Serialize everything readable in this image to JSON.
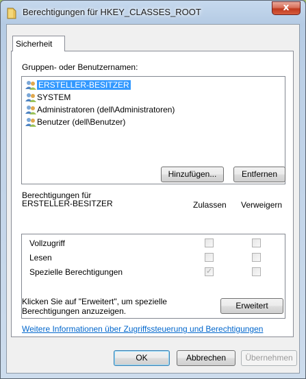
{
  "window": {
    "title": "Berechtigungen für HKEY_CLASSES_ROOT",
    "close_label": "x"
  },
  "tabs": [
    {
      "label": "Sicherheit",
      "active": true
    }
  ],
  "groups": {
    "label": "Gruppen- oder Benutzernamen:",
    "items": [
      {
        "label": "ERSTELLER-BESITZER",
        "selected": true
      },
      {
        "label": "SYSTEM",
        "selected": false
      },
      {
        "label": "Administratoren (dell\\Administratoren)",
        "selected": false
      },
      {
        "label": "Benutzer (dell\\Benutzer)",
        "selected": false
      }
    ],
    "add_label": "Hinzufügen...",
    "remove_label": "Entfernen"
  },
  "permissions": {
    "heading_line1": "Berechtigungen für",
    "heading_line2": "ERSTELLER-BESITZER",
    "allow_header": "Zulassen",
    "deny_header": "Verweigern",
    "rows": [
      {
        "name": "Vollzugriff",
        "allow": false,
        "deny": false
      },
      {
        "name": "Lesen",
        "allow": false,
        "deny": false
      },
      {
        "name": "Spezielle Berechtigungen",
        "allow": true,
        "deny": false
      }
    ]
  },
  "advanced": {
    "text_line1": "Klicken Sie auf \"Erweitert\", um spezielle",
    "text_line2": "Berechtigungen anzuzeigen.",
    "button_label": "Erweitert"
  },
  "info_link": "Weitere Informationen über Zugriffssteuerung und Berechtigungen",
  "footer": {
    "ok_label": "OK",
    "cancel_label": "Abbrechen",
    "apply_label": "Übernehmen"
  },
  "colors": {
    "selection": "#3399ff",
    "link": "#0066cc"
  }
}
